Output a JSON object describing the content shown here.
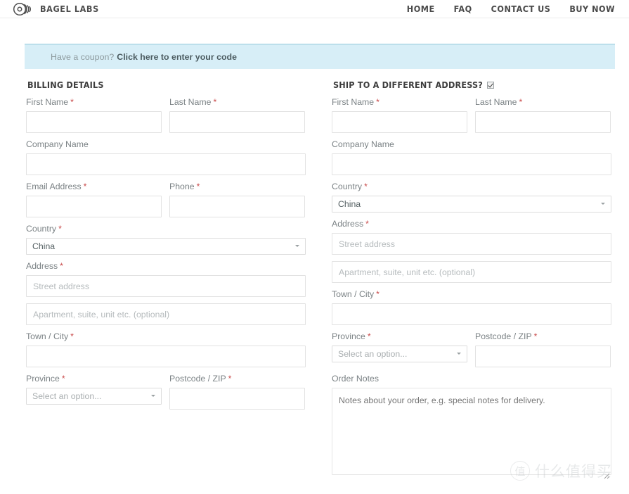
{
  "header": {
    "brand_name": "BAGEL LABS",
    "logo_icon": "bagel-rings-logo",
    "nav": [
      {
        "label": "HOME",
        "name": "nav-home"
      },
      {
        "label": "FAQ",
        "name": "nav-faq"
      },
      {
        "label": "CONTACT US",
        "name": "nav-contact-us"
      },
      {
        "label": "BUY NOW",
        "name": "nav-buy-now"
      }
    ]
  },
  "coupon": {
    "prompt": "Have a coupon?",
    "link_label": "Click here to enter your code",
    "background_color": "#d7eef7",
    "border_color": "#bcdfeb"
  },
  "billing": {
    "title": "BILLING DETAILS",
    "first_name": {
      "label": "First Name",
      "required": true,
      "value": "",
      "placeholder": ""
    },
    "last_name": {
      "label": "Last Name",
      "required": true,
      "value": "",
      "placeholder": ""
    },
    "company_name": {
      "label": "Company Name",
      "required": false,
      "value": "",
      "placeholder": ""
    },
    "email_address": {
      "label": "Email Address",
      "required": true,
      "value": "",
      "placeholder": ""
    },
    "phone": {
      "label": "Phone",
      "required": true,
      "value": "",
      "placeholder": ""
    },
    "country": {
      "label": "Country",
      "required": true,
      "value": "China"
    },
    "address": {
      "label": "Address",
      "required": true
    },
    "address_line1_placeholder": "Street address",
    "address_line2_placeholder": "Apartment, suite, unit etc. (optional)",
    "town_city": {
      "label": "Town / City",
      "required": true,
      "value": "",
      "placeholder": ""
    },
    "province": {
      "label": "Province",
      "required": true,
      "value": "Select an option..."
    },
    "postcode": {
      "label": "Postcode / ZIP",
      "required": true,
      "value": "",
      "placeholder": ""
    }
  },
  "shipping": {
    "title": "SHIP TO A DIFFERENT ADDRESS?",
    "checkbox_checked": true,
    "first_name": {
      "label": "First Name",
      "required": true,
      "value": "",
      "placeholder": ""
    },
    "last_name": {
      "label": "Last Name",
      "required": true,
      "value": "",
      "placeholder": ""
    },
    "company_name": {
      "label": "Company Name",
      "required": false,
      "value": "",
      "placeholder": ""
    },
    "country": {
      "label": "Country",
      "required": true,
      "value": "China"
    },
    "address": {
      "label": "Address",
      "required": true
    },
    "address_line1_placeholder": "Street address",
    "address_line2_placeholder": "Apartment, suite, unit etc. (optional)",
    "town_city": {
      "label": "Town / City",
      "required": true,
      "value": "",
      "placeholder": ""
    },
    "province": {
      "label": "Province",
      "required": true,
      "value": "Select an option..."
    },
    "postcode": {
      "label": "Postcode / ZIP",
      "required": true,
      "value": "",
      "placeholder": ""
    },
    "order_notes": {
      "label": "Order Notes",
      "placeholder": "Notes about your order, e.g. special notes for delivery.",
      "value": ""
    }
  },
  "watermark": {
    "badge_glyph": "值",
    "text": "什么值得买"
  },
  "colors": {
    "required_asterisk": "#c94b4b",
    "label_text": "#7b8285",
    "input_border": "#e2e2e2",
    "heading_text": "#3d3d3d"
  }
}
